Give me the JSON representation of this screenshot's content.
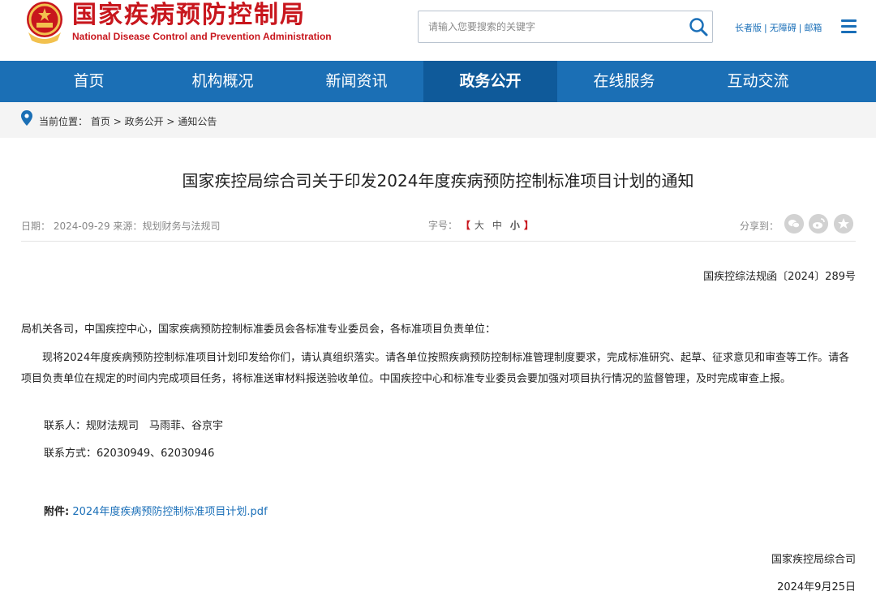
{
  "header": {
    "site_name_cn": "国家疾病预防控制局",
    "site_name_en": "National Disease Control and Prevention Administration",
    "search_placeholder": "请输入您要搜索的关键字",
    "links": [
      "长者版",
      "无障碍",
      "邮箱"
    ]
  },
  "nav": {
    "items": [
      "首页",
      "机构概况",
      "新闻资讯",
      "政务公开",
      "在线服务",
      "互动交流"
    ],
    "active_index": 3
  },
  "breadcrumb": {
    "label": "当前位置：",
    "items": [
      "首页",
      "政务公开",
      "通知公告"
    ],
    "separator": ">"
  },
  "article": {
    "title": "国家疾控局综合司关于印发2024年度疾病预防控制标准项目计划的通知",
    "date_label": "日期：",
    "date": "2024-09-29",
    "source_label": "来源：",
    "source": "规划财务与法规司",
    "fontsize_label": "字号：",
    "fontsize_options": [
      "大",
      "中",
      "小"
    ],
    "share_label": "分享到：",
    "doc_number": "国疾控综法规函〔2024〕289号",
    "salutation": "局机关各司，中国疾控中心，国家疾病预防控制标准委员会各标准专业委员会，各标准项目负责单位：",
    "body": "现将2024年度疾病预防控制标准项目计划印发给你们，请认真组织落实。请各单位按照疾病预防控制标准管理制度要求，完成标准研究、起草、征求意见和审查等工作。请各项目负责单位在规定的时间内完成项目任务，将标准送审材料报送验收单位。中国疾控中心和标准专业委员会要加强对项目执行情况的监督管理，及时完成审查上报。",
    "contact_person": "联系人：规财法规司　马雨菲、谷京宇",
    "contact_phone": "联系方式：62030949、62030946",
    "attachment_label": "附件:",
    "attachment_name": "2024年度疾病预防控制标准项目计划.pdf",
    "sign_org": "国家疾控局综合司",
    "sign_date": "2024年9月25日"
  },
  "colors": {
    "brand_red": "#c8161d",
    "nav_blue": "#1b6fb5",
    "nav_active": "#0f5a9a",
    "link_blue": "#1a6fb8"
  },
  "icons": [
    "national-emblem-icon",
    "search-icon",
    "menu-icon",
    "location-pin-icon",
    "wechat-share-icon",
    "weibo-share-icon",
    "favorite-share-icon"
  ]
}
